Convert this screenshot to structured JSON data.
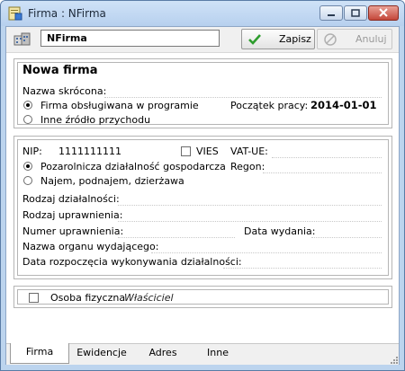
{
  "window": {
    "title": "Firma : NFirma"
  },
  "toolbar": {
    "name_value": "NFirma",
    "save_label": "Zapisz",
    "cancel_label": "Anuluj"
  },
  "header": {
    "heading": "Nowa firma",
    "short_name_label": "Nazwa skrócona:",
    "radio_program": "Firma obsługiwana w programie",
    "radio_other": "Inne źródło przychodu",
    "start_label": "Początek pracy:",
    "start_value": "2014-01-01"
  },
  "details": {
    "nip_label": "NIP:",
    "nip_value": "1111111111",
    "vies_label": "VIES",
    "vatue_label": "VAT-UE:",
    "radio_business": "Pozarolnicza działalność gospodarcza",
    "radio_rent": "Najem, podnajem, dzierżawa",
    "regon_label": "Regon:",
    "activity_label": "Rodzaj działalności:",
    "permission_label": "Rodzaj uprawnienia:",
    "permission_no_label": "Numer uprawnienia:",
    "issue_date_label": "Data wydania:",
    "authority_label": "Nazwa organu wydającego:",
    "start_activity_label": "Data rozpoczęcia wykonywania działalności:"
  },
  "owner": {
    "person_label": "Osoba fizyczna",
    "owner_placeholder": "Właściciel"
  },
  "tabs": [
    {
      "label": "Firma",
      "active": true
    },
    {
      "label": "Ewidencje",
      "active": false
    },
    {
      "label": "Adres",
      "active": false
    },
    {
      "label": "Inne",
      "active": false
    }
  ],
  "colors": {
    "titlebar": "#b7d0ee",
    "close_button": "#c4473a",
    "save_check": "#2e9d2e"
  },
  "icons": [
    "app-icon",
    "minimize-icon",
    "maximize-icon",
    "close-icon",
    "company-icon",
    "checkmark-icon",
    "cancel-icon",
    "resize-grip-icon"
  ]
}
